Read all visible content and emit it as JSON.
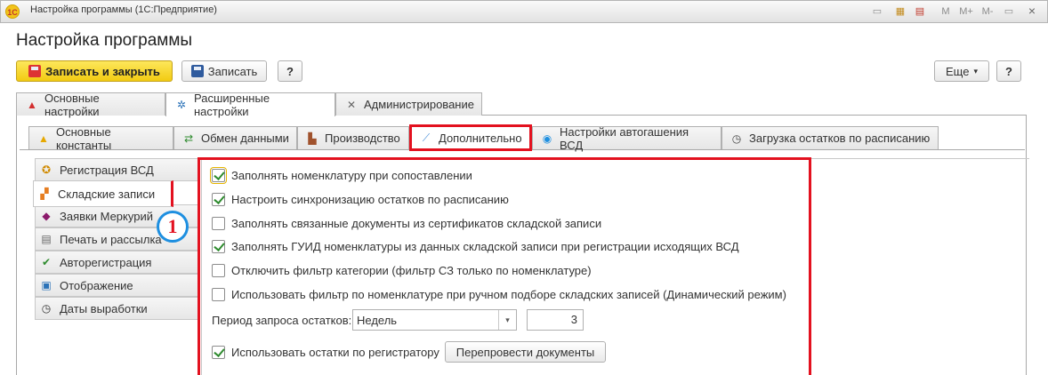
{
  "window": {
    "title": "Настройка программы  (1С:Предприятие)",
    "app_logo": "1С",
    "toolbar_icons": [
      "M",
      "M+",
      "M-"
    ],
    "close_glyph": "×"
  },
  "page": {
    "title": "Настройка программы"
  },
  "toolbar": {
    "save_close_label": "Записать и закрыть",
    "save_label": "Записать",
    "help_label": "?",
    "more_label": "Еще",
    "more_arrow": "▾",
    "help2_label": "?"
  },
  "tabs_main": [
    {
      "label": "Основные настройки",
      "icon": "warning-icon"
    },
    {
      "label": "Расширенные настройки",
      "icon": "settings-icon",
      "active": true
    },
    {
      "label": "Администрирование",
      "icon": "tools-icon"
    }
  ],
  "tabs_sub": [
    {
      "label": "Основные константы",
      "icon": "warning-icon"
    },
    {
      "label": "Обмен данными",
      "icon": "exchange-icon"
    },
    {
      "label": "Производство",
      "icon": "factory-icon"
    },
    {
      "label": "Дополнительно",
      "icon": "syringe-icon",
      "active": true,
      "highlighted": true
    },
    {
      "label": "Настройки автогашения ВСД",
      "icon": "auto-icon"
    },
    {
      "label": "Загрузка остатков по расписанию",
      "icon": "clock-icon"
    }
  ],
  "side_list": [
    {
      "label": "Регистрация ВСД",
      "icon": "certificate-icon"
    },
    {
      "label": "Складские записи",
      "icon": "blocks-icon",
      "active": true,
      "highlighted": true
    },
    {
      "label": "Заявки Меркурий",
      "icon": "box-icon"
    },
    {
      "label": "Печать и рассылка",
      "icon": "printer-icon"
    },
    {
      "label": "Авторегистрация",
      "icon": "check-icon"
    },
    {
      "label": "Отображение",
      "icon": "display-icon"
    },
    {
      "label": "Даты выработки",
      "icon": "clock-icon"
    }
  ],
  "options": [
    {
      "label": "Заполнять номенклатуру при сопоставлении",
      "checked": true,
      "focused": true
    },
    {
      "label": "Настроить синхронизацию остатков по расписанию",
      "checked": true
    },
    {
      "label": "Заполнять связанные документы из сертификатов складской записи",
      "checked": false
    },
    {
      "label": "Заполнять ГУИД номенклатуры из данных складской записи при регистрации исходящих ВСД",
      "checked": true
    },
    {
      "label": "Отключить фильтр категории (фильтр СЗ только по номенклатуре)",
      "checked": false
    },
    {
      "label": "Использовать фильтр по номенклатуре при ручном подборе складских записей (Динамический режим)",
      "checked": false
    }
  ],
  "period": {
    "label": "Период запроса остатков:",
    "value": "Недель",
    "count": "3"
  },
  "use_register": {
    "label": "Использовать остатки по регистратору",
    "checked": true,
    "button_label": "Перепровести документы"
  },
  "annotation": {
    "badge": "1"
  },
  "colors": {
    "highlight": "#e3111f",
    "badge_ring": "#1e8fe0",
    "primary_button": "#f2cb12",
    "check": "#2e8b2e"
  }
}
